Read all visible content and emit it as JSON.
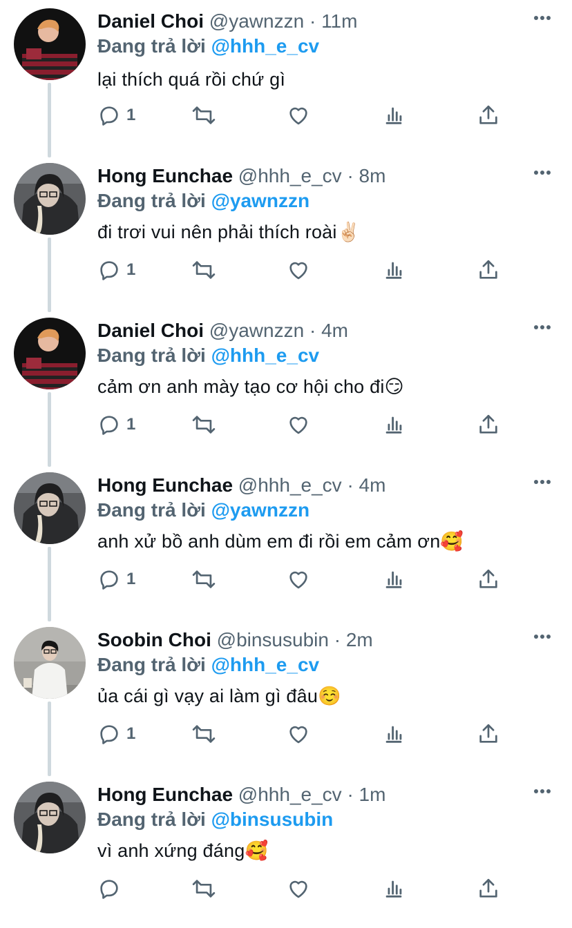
{
  "labels": {
    "replying_prefix": "Đang trả lời"
  },
  "colors": {
    "accent": "#1d9bf0",
    "text": "#0f1419",
    "secondary": "#536471",
    "thread_line": "#cfd9de"
  },
  "tweets": [
    {
      "name": "Daniel Choi",
      "handle": "@yawnzzn",
      "time": "11m",
      "replying_to": "@hhh_e_cv",
      "text": "lại thích quá rồi chứ gì",
      "reply_count": "1",
      "avatar": "daniel"
    },
    {
      "name": "Hong Eunchae",
      "handle": "@hhh_e_cv",
      "time": "8m",
      "replying_to": "@yawnzzn",
      "text": "đi trơi vui nên phải thích roài",
      "emoji": "✌🏻",
      "reply_count": "1",
      "avatar": "eunchae"
    },
    {
      "name": "Daniel Choi",
      "handle": "@yawnzzn",
      "time": "4m",
      "replying_to": "@hhh_e_cv",
      "text": "cảm ơn anh mày tạo cơ hội cho đi",
      "emoji": "😏",
      "reply_count": "1",
      "avatar": "daniel"
    },
    {
      "name": "Hong Eunchae",
      "handle": "@hhh_e_cv",
      "time": "4m",
      "replying_to": "@yawnzzn",
      "text": "anh xử bồ anh dùm em đi rồi em cảm ơn",
      "emoji": "🥰",
      "reply_count": "1",
      "avatar": "eunchae"
    },
    {
      "name": "Soobin Choi",
      "handle": "@binsusubin",
      "time": "2m",
      "replying_to": "@hhh_e_cv",
      "text": "ủa cái gì vạy ai làm gì đâu",
      "emoji": "☺️",
      "reply_count": "1",
      "avatar": "soobin"
    },
    {
      "name": "Hong Eunchae",
      "handle": "@hhh_e_cv",
      "time": "1m",
      "replying_to": "@binsusubin",
      "text": "vì anh xứng đáng",
      "emoji": "🥰",
      "reply_count": "",
      "avatar": "eunchae"
    }
  ]
}
